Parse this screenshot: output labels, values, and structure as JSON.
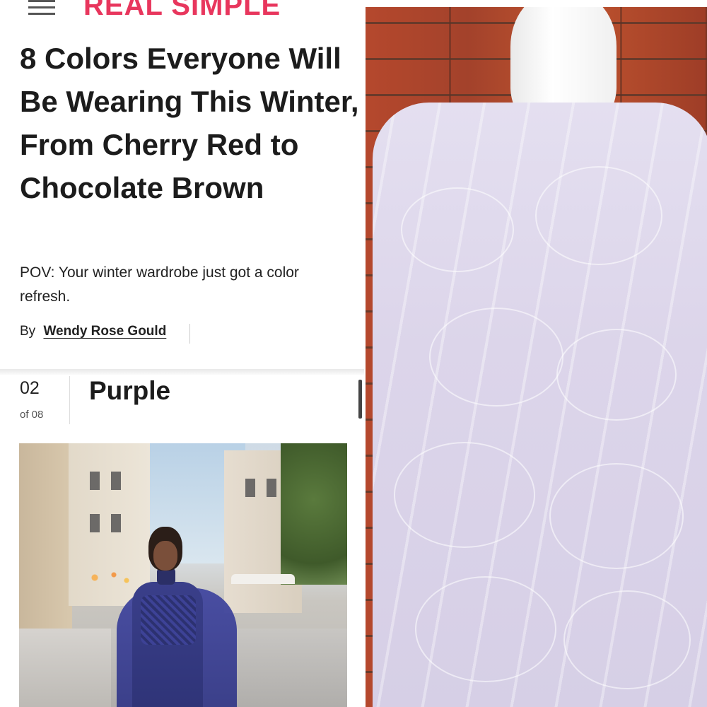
{
  "header": {
    "brand": "REAL SIMPLE",
    "menu_icon": "hamburger-menu-icon"
  },
  "article": {
    "headline": "8 Colors Everyone Will Be Wearing This Winter, From Cherry Red to Chocolate Brown",
    "dek": "POV: Your winter wardrobe just got a color refresh.",
    "byline_prefix": "By",
    "author": "Wendy Rose Gould"
  },
  "slide": {
    "number": "02",
    "of_label": "of 08",
    "title": "Purple"
  },
  "colors": {
    "brand": "#e8365d",
    "text": "#1c1c1c"
  }
}
